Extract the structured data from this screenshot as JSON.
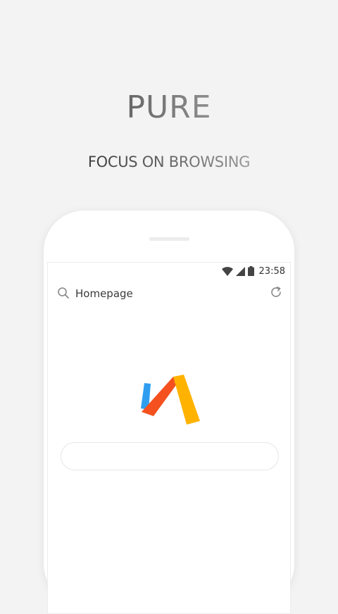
{
  "headline": "PURE",
  "tagline": "FOCUS ON BROWSING",
  "status_bar": {
    "time": "23:58",
    "icons": [
      "wifi-icon",
      "signal-icon",
      "battery-icon"
    ]
  },
  "address_bar": {
    "text": "Homepage",
    "left_icon": "search-icon",
    "right_icon": "reload-icon"
  },
  "logo": {
    "name": "via-logo",
    "colors": {
      "blue": "#2f9ef0",
      "red": "#f4511e",
      "yellow": "#ffb300"
    }
  },
  "search_box": {
    "value": "",
    "placeholder": ""
  },
  "colors": {
    "background": "#f3f3f3",
    "device": "#ffffff"
  }
}
